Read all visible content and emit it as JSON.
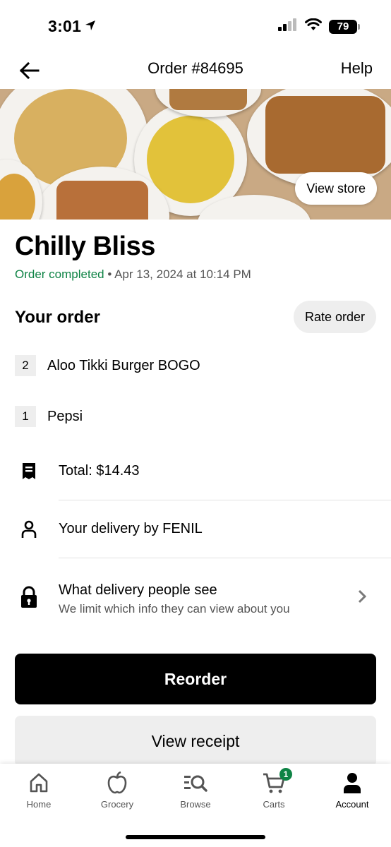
{
  "status_bar": {
    "time": "3:01",
    "battery": "79"
  },
  "nav": {
    "title": "Order #84695",
    "help": "Help"
  },
  "hero": {
    "view_store": "View store"
  },
  "store": {
    "name": "Chilly Bliss",
    "status": "Order completed",
    "separator": " • ",
    "date": "Apr 13, 2024 at 10:14 PM"
  },
  "order": {
    "title": "Your order",
    "rate_label": "Rate order",
    "items": [
      {
        "qty": "2",
        "name": "Aloo Tikki Burger BOGO"
      },
      {
        "qty": "1",
        "name": "Pepsi"
      }
    ]
  },
  "details": {
    "total": "Total: $14.43",
    "delivery": "Your delivery by FENIL",
    "privacy_title": "What delivery people see",
    "privacy_sub": "We limit which info they can view about you"
  },
  "actions": {
    "reorder": "Reorder",
    "receipt": "View receipt"
  },
  "tabs": [
    {
      "label": "Home",
      "icon": "home-icon"
    },
    {
      "label": "Grocery",
      "icon": "apple-icon"
    },
    {
      "label": "Browse",
      "icon": "browse-icon"
    },
    {
      "label": "Carts",
      "icon": "cart-icon",
      "badge": "1"
    },
    {
      "label": "Account",
      "icon": "person-icon",
      "active": true
    }
  ],
  "colors": {
    "accent_green": "#0e8345",
    "primary": "#000000",
    "secondary_bg": "#eeeeee"
  }
}
